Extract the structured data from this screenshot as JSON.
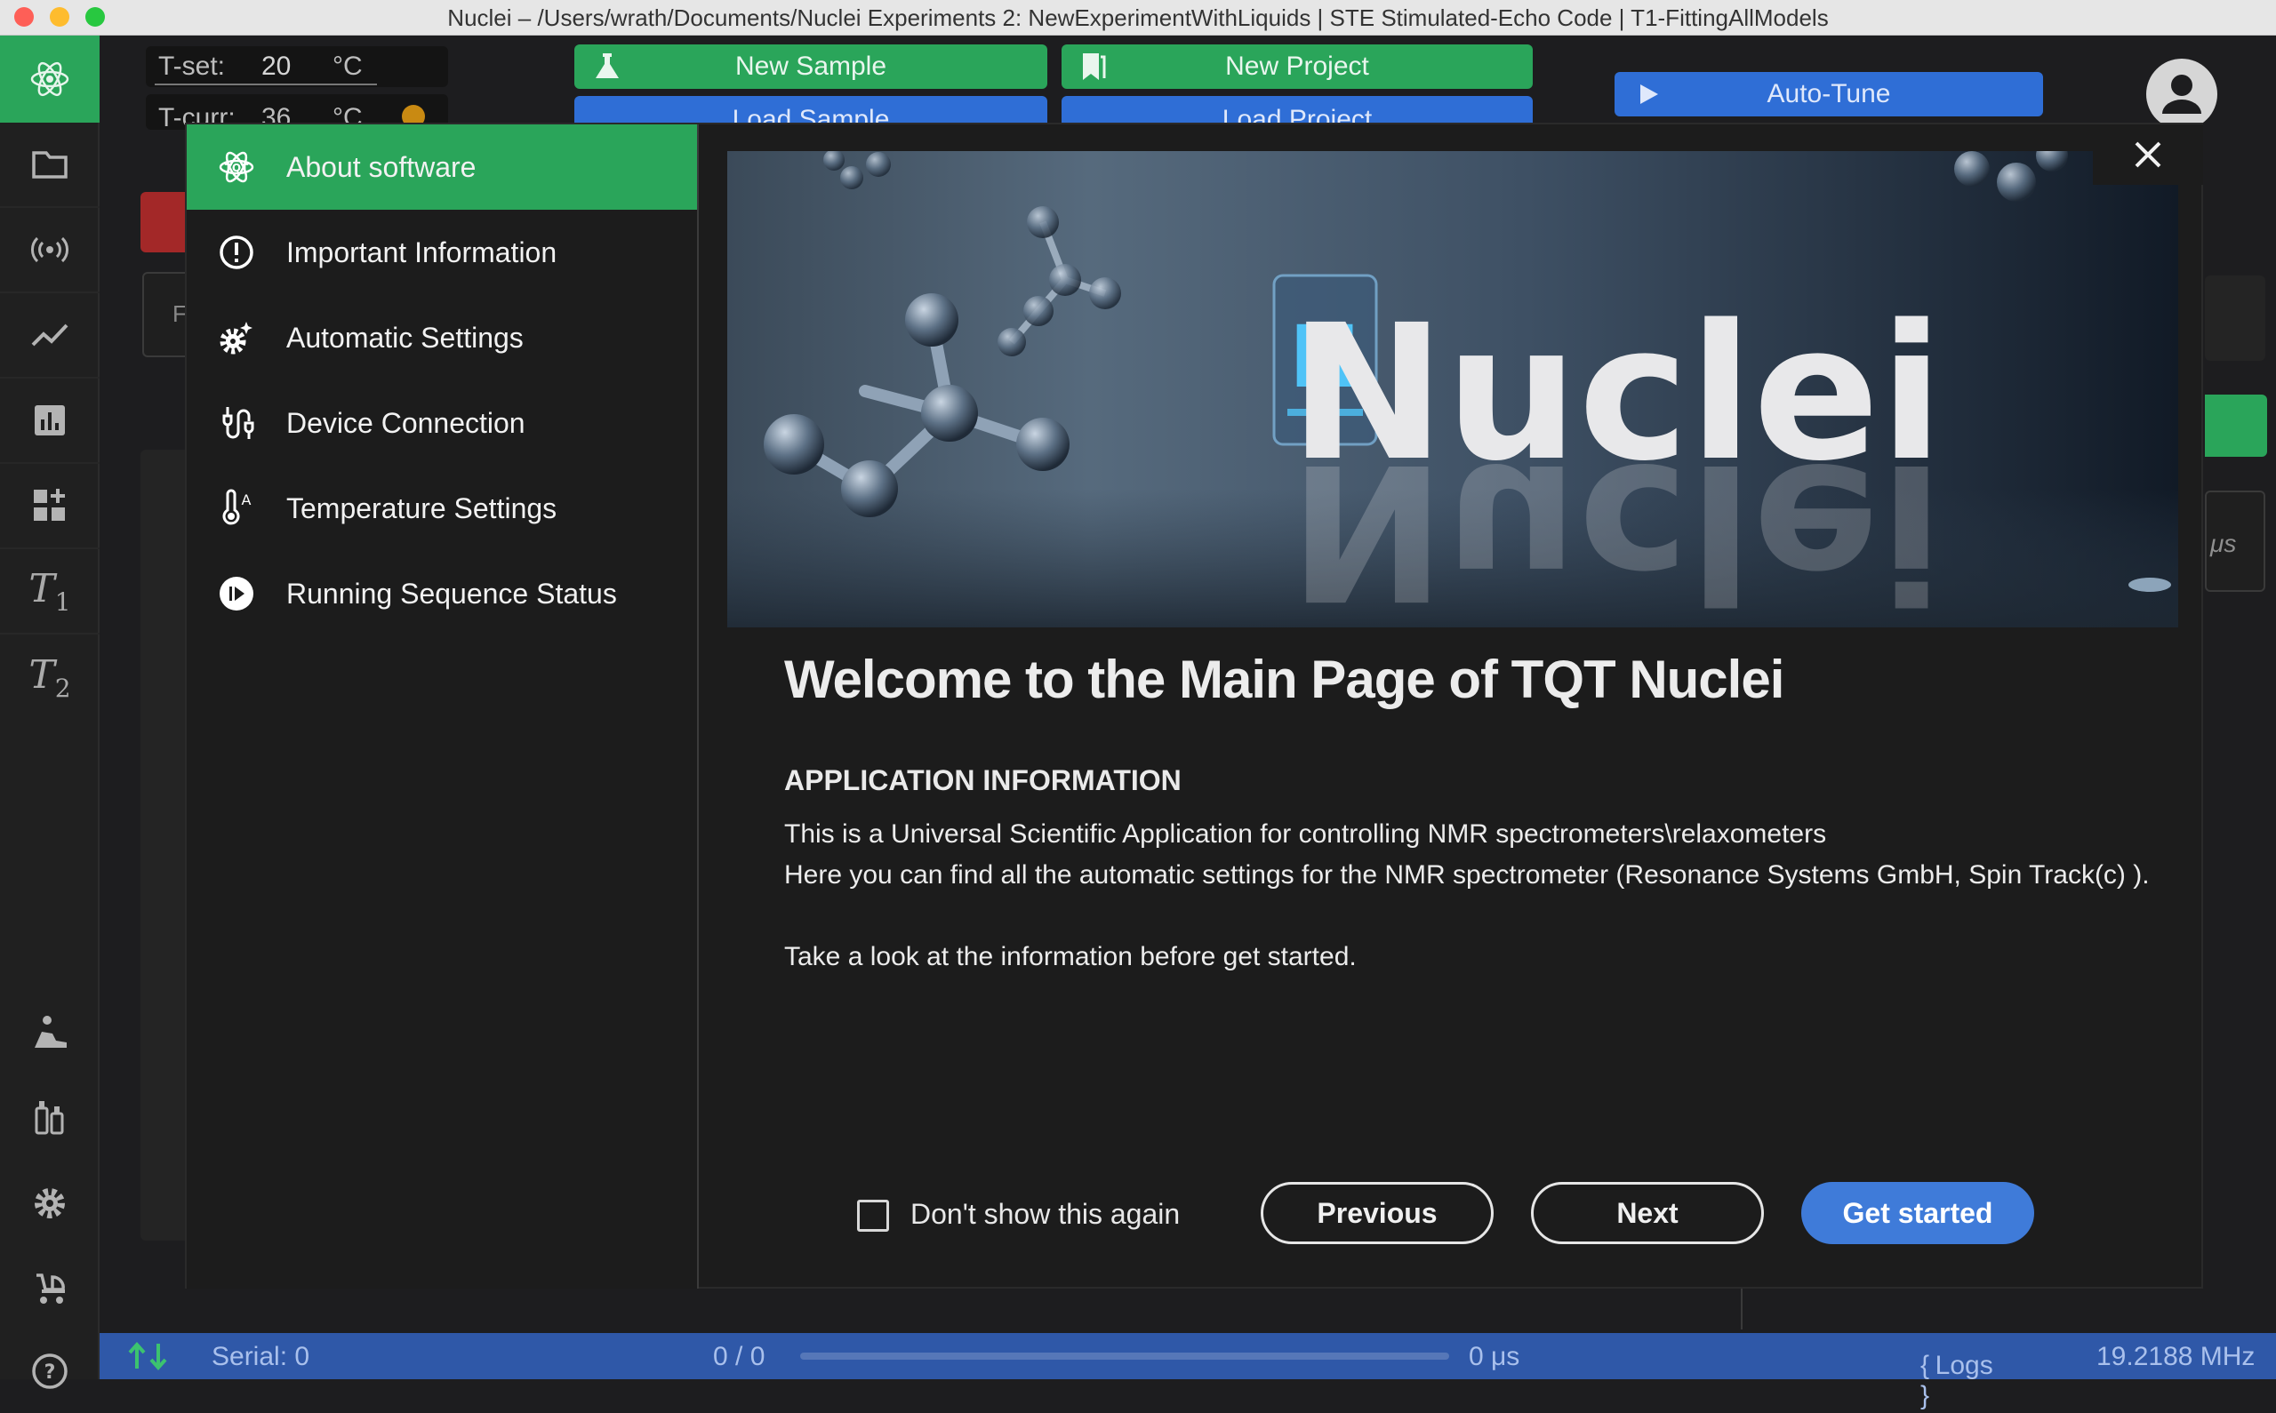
{
  "window": {
    "title": "Nuclei – /Users/wrath/Documents/Nuclei Experiments 2: NewExperimentWithLiquids | STE Stimulated-Echo Code | T1-FittingAllModels",
    "traffic_lights": [
      "#fe5f57",
      "#febc2e",
      "#28c840"
    ]
  },
  "header": {
    "t_set_label": "T-set:",
    "t_set_value": "20",
    "t_set_unit": "°C",
    "t_curr_label": "T-curr:",
    "t_curr_value": "36",
    "t_curr_unit": "°C",
    "new_sample": "New Sample",
    "new_project": "New Project",
    "load_sample": "Load Sample",
    "load_project": "Load Project",
    "auto_tune": "Auto-Tune"
  },
  "rail": {
    "t1_symbol": "T",
    "t1_sub": "1",
    "t2_symbol": "T",
    "t2_sub": "2"
  },
  "background_panel": {
    "partial_letter": "F",
    "unit_label": "μs"
  },
  "status_bar": {
    "serial": "Serial: 0",
    "progress": "0 / 0",
    "time": "0 μs",
    "logs": "Logs",
    "frequency": "19.2188 MHz"
  },
  "modal": {
    "nav": [
      {
        "label": "About software",
        "icon": "tqt-atom-icon",
        "active": true
      },
      {
        "label": "Important Information",
        "icon": "alert-circle-icon",
        "active": false
      },
      {
        "label": "Automatic Settings",
        "icon": "auto-gear-icon",
        "active": false
      },
      {
        "label": "Device Connection",
        "icon": "cable-connection-icon",
        "active": false
      },
      {
        "label": "Temperature Settings",
        "icon": "thermometer-auto-icon",
        "active": false
      },
      {
        "label": "Running Sequence Status",
        "icon": "play-status-icon",
        "active": false
      }
    ],
    "hero_text": "Nuclei",
    "hero_badge_letter": "N",
    "welcome_title": "Welcome to the Main Page of TQT Nuclei",
    "section_heading": "APPLICATION INFORMATION",
    "para1": "This is a Universal Scientific Application for controlling NMR spectrometers\\relaxometers",
    "para2": "Here you can find all the automatic settings for the NMR spectrometer (Resonance Systems GmbH, Spin Track(c) ).",
    "para3": "Take a look at the information before get started.",
    "dont_show": "Don't show this again",
    "dont_show_checked": false,
    "previous": "Previous",
    "next": "Next",
    "get_started": "Get started"
  },
  "colors": {
    "accent_green": "#2aa55a",
    "primary_blue": "#3f7bd9",
    "status_blue": "#2f58a8"
  }
}
